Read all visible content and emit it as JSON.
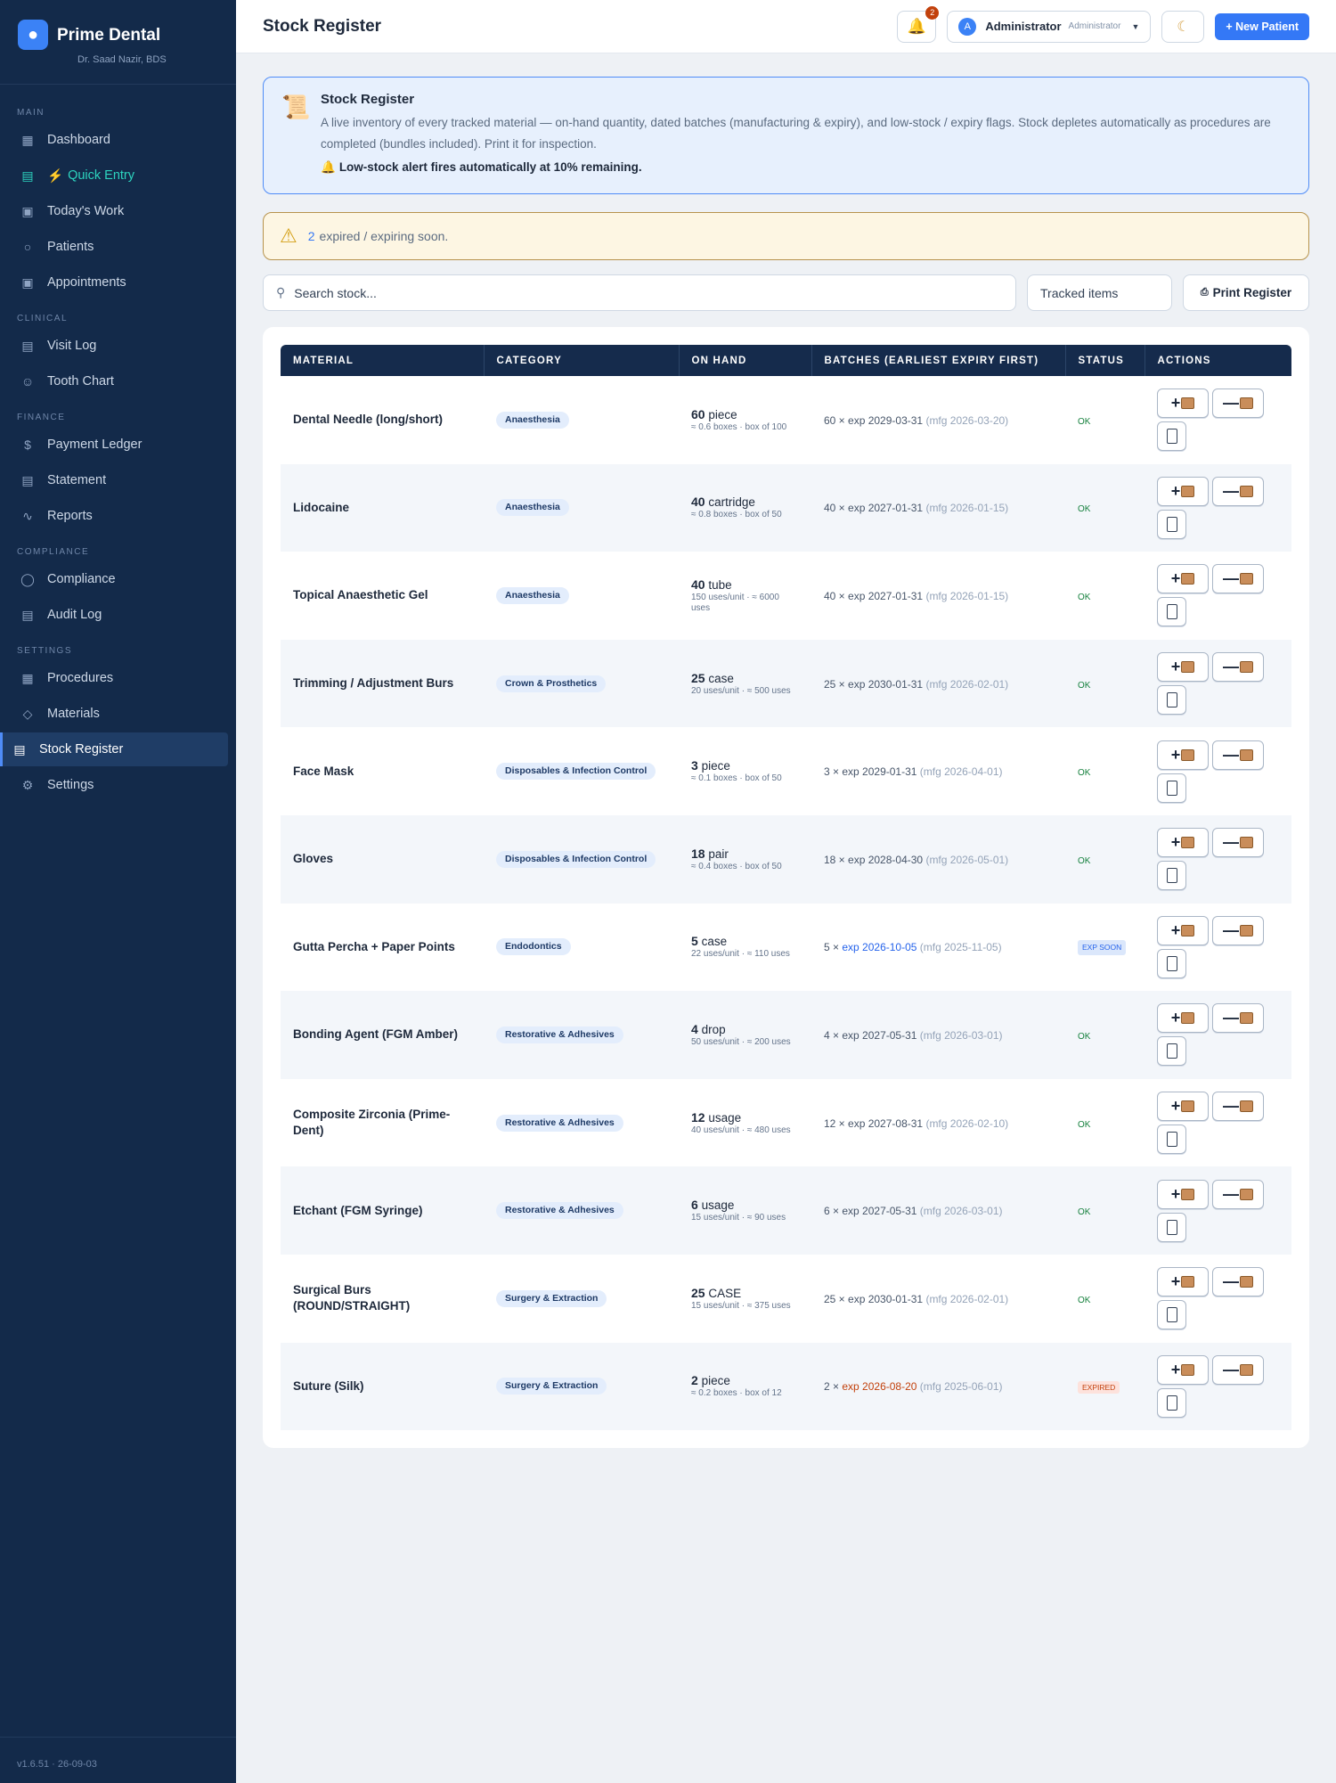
{
  "brand": {
    "name": "Prime Dental",
    "sub": "Dr. Saad Nazir, BDS",
    "logo": "tooth-icon"
  },
  "sidebar": {
    "sections": {
      "main": "MAIN",
      "clinical": "CLINICAL",
      "finance": "FINANCE",
      "compliance": "COMPLIANCE",
      "settings": "SETTINGS"
    },
    "items": {
      "dashboard": "Dashboard",
      "quick_entry": "Quick Entry",
      "todays_work": "Today's Work",
      "patients": "Patients",
      "appointments": "Appointments",
      "visit_log": "Visit Log",
      "tooth_chart": "Tooth Chart",
      "payment_ledger": "Payment Ledger",
      "statement": "Statement",
      "reports": "Reports",
      "compliance": "Compliance",
      "audit_log": "Audit Log",
      "procedures": "Procedures",
      "materials": "Materials",
      "stock_register": "Stock Register",
      "settings": "Settings"
    },
    "version": "v1.6.51 · 26-09-03"
  },
  "topbar": {
    "title": "Stock Register",
    "notif_count": "2",
    "user_initial": "A",
    "user_name": "Administrator",
    "user_role": "Administrator",
    "new_patient": "+ New Patient"
  },
  "info": {
    "title": "Stock Register",
    "desc": "A live inventory of every tracked material — on-hand quantity, dated batches (manufacturing & expiry), and low-stock / expiry flags. Stock depletes automatically as procedures are completed (bundles included). Print it for inspection.",
    "alert": "Low-stock alert fires automatically at 10% remaining."
  },
  "warning": {
    "count": "2",
    "text": "expired / expiring soon."
  },
  "filters": {
    "search_placeholder": "Search stock...",
    "select_value": "Tracked items",
    "print": "Print Register"
  },
  "table": {
    "headers": [
      "Material",
      "Category",
      "On Hand",
      "Batches (earliest expiry first)",
      "Status",
      "Actions"
    ],
    "rows": [
      {
        "material": "Dental Needle (long/short)",
        "category": "Anaesthesia",
        "qty": "60",
        "unit": "piece",
        "sub": "≈ 0.6 boxes · box of 100",
        "batch_qty": "60 × ",
        "exp": "exp 2029-03-31",
        "mfg": " (mfg 2026-03-20)",
        "status": "OK",
        "status_type": "ok"
      },
      {
        "material": "Lidocaine",
        "category": "Anaesthesia",
        "qty": "40",
        "unit": "cartridge",
        "sub": "≈ 0.8 boxes · box of 50",
        "batch_qty": "40 × ",
        "exp": "exp 2027-01-31",
        "mfg": " (mfg 2026-01-15)",
        "status": "OK",
        "status_type": "ok"
      },
      {
        "material": "Topical Anaesthetic Gel",
        "category": "Anaesthesia",
        "qty": "40",
        "unit": "tube",
        "sub": "150 uses/unit · ≈ 6000 uses",
        "batch_qty": "40 × ",
        "exp": "exp 2027-01-31",
        "mfg": " (mfg 2026-01-15)",
        "status": "OK",
        "status_type": "ok"
      },
      {
        "material": "Trimming / Adjustment Burs",
        "category": "Crown & Prosthetics",
        "qty": "25",
        "unit": "case",
        "sub": "20 uses/unit · ≈ 500 uses",
        "batch_qty": "25 × ",
        "exp": "exp 2030-01-31",
        "mfg": " (mfg 2026-02-01)",
        "status": "OK",
        "status_type": "ok"
      },
      {
        "material": "Face Mask",
        "category": "Disposables & Infection Control",
        "qty": "3",
        "unit": "piece",
        "sub": "≈ 0.1 boxes · box of 50",
        "batch_qty": "3 × ",
        "exp": "exp 2029-01-31",
        "mfg": " (mfg 2026-04-01)",
        "status": "OK",
        "status_type": "ok"
      },
      {
        "material": "Gloves",
        "category": "Disposables & Infection Control",
        "qty": "18",
        "unit": "pair",
        "sub": "≈ 0.4 boxes · box of 50",
        "batch_qty": "18 × ",
        "exp": "exp 2028-04-30",
        "mfg": " (mfg 2026-05-01)",
        "status": "OK",
        "status_type": "ok"
      },
      {
        "material": "Gutta Percha + Paper Points",
        "category": "Endodontics",
        "qty": "5",
        "unit": "case",
        "sub": "22 uses/unit · ≈ 110 uses",
        "batch_qty": "5 × ",
        "exp": "exp 2026-10-05",
        "mfg": " (mfg 2025-11-05)",
        "status": "EXP SOON",
        "status_type": "soon"
      },
      {
        "material": "Bonding Agent (FGM Amber)",
        "category": "Restorative & Adhesives",
        "qty": "4",
        "unit": "drop",
        "sub": "50 uses/unit · ≈ 200 uses",
        "batch_qty": "4 × ",
        "exp": "exp 2027-05-31",
        "mfg": " (mfg 2026-03-01)",
        "status": "OK",
        "status_type": "ok"
      },
      {
        "material": "Composite Zirconia (Prime-Dent)",
        "category": "Restorative & Adhesives",
        "qty": "12",
        "unit": "usage",
        "sub": "40 uses/unit · ≈ 480 uses",
        "batch_qty": "12 × ",
        "exp": "exp 2027-08-31",
        "mfg": " (mfg 2026-02-10)",
        "status": "OK",
        "status_type": "ok"
      },
      {
        "material": "Etchant (FGM Syringe)",
        "category": "Restorative & Adhesives",
        "qty": "6",
        "unit": "usage",
        "sub": "15 uses/unit · ≈ 90 uses",
        "batch_qty": "6 × ",
        "exp": "exp 2027-05-31",
        "mfg": " (mfg 2026-03-01)",
        "status": "OK",
        "status_type": "ok"
      },
      {
        "material": "Surgical Burs (ROUND/STRAIGHT)",
        "category": "Surgery & Extraction",
        "qty": "25",
        "unit": "CASE",
        "sub": "15 uses/unit · ≈ 375 uses",
        "batch_qty": "25 × ",
        "exp": "exp 2030-01-31",
        "mfg": " (mfg 2026-02-01)",
        "status": "OK",
        "status_type": "ok"
      },
      {
        "material": "Suture (Silk)",
        "category": "Surgery & Extraction",
        "qty": "2",
        "unit": "piece",
        "sub": "≈ 0.2 boxes · box of 12",
        "batch_qty": "2 × ",
        "exp": "exp 2026-08-20",
        "mfg": " (mfg 2025-06-01)",
        "status": "EXPIRED",
        "status_type": "expired"
      }
    ]
  },
  "colors": {
    "sidebar": "#132a4a",
    "accent": "#3478f6",
    "ok": "#15803d",
    "expired": "#c2410c"
  }
}
